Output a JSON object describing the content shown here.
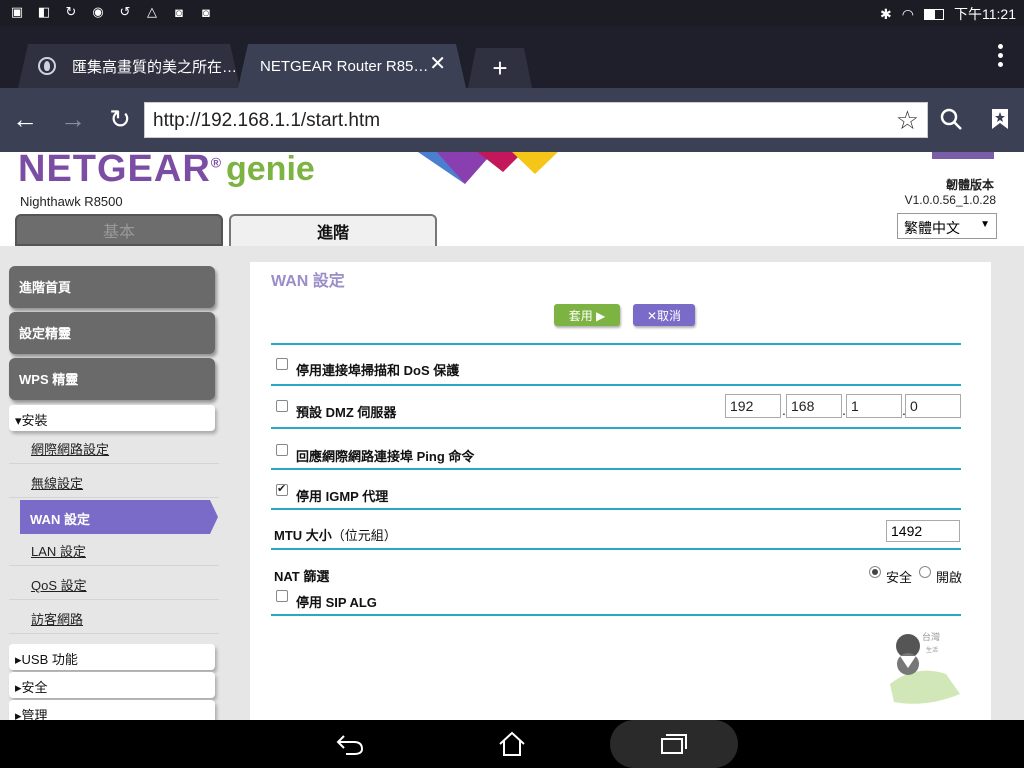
{
  "status_bar": {
    "time": "下午11:21",
    "left_icons": [
      "image-icon",
      "asus-icon",
      "sync-icon",
      "app-icon",
      "refresh-icon",
      "warning-icon",
      "camera-icon",
      "camera-icon"
    ],
    "right_icons": [
      "bluetooth-icon",
      "wifi-icon",
      "battery-icon"
    ]
  },
  "browser": {
    "tabs": [
      {
        "title": "匯集高畫質的美之所在…",
        "active": false
      },
      {
        "title": "NETGEAR Router R85…",
        "active": true
      }
    ],
    "new_tab_label": "+",
    "url": "http://192.168.1.1/start.htm"
  },
  "router_header": {
    "brand": "NETGEAR",
    "trademark": "®",
    "product": "genie",
    "model": "Nighthawk R8500",
    "firmware_label": "韌體版本",
    "firmware_version": "V1.0.0.56_1.0.28",
    "language": "繁體中文",
    "tabs": {
      "basic": "基本",
      "advanced": "進階"
    }
  },
  "sidebar": {
    "big_buttons": [
      "進階首頁",
      "設定精靈",
      "WPS 精靈"
    ],
    "setup_group": "▾安裝",
    "setup_items": [
      {
        "label": "網際網路設定",
        "active": false
      },
      {
        "label": "無線設定",
        "active": false
      },
      {
        "label": "WAN 設定",
        "active": true
      },
      {
        "label": "LAN 設定",
        "active": false
      },
      {
        "label": "QoS 設定",
        "active": false
      },
      {
        "label": "訪客網路",
        "active": false
      }
    ],
    "collapsed_groups": [
      "▸USB 功能",
      "▸安全",
      "▸管理"
    ]
  },
  "wan": {
    "title": "WAN 設定",
    "apply_label": "套用 ▶",
    "cancel_label": "✕取消",
    "disable_portscan_dos": {
      "label": "停用連接埠掃描和 DoS 保護",
      "checked": false
    },
    "default_dmz": {
      "label": "預設 DMZ 伺服器",
      "checked": false,
      "ip": [
        "192",
        "168",
        "1",
        "0"
      ]
    },
    "respond_ping": {
      "label": "回應網際網路連接埠 Ping 命令",
      "checked": false
    },
    "disable_igmp": {
      "label": "停用 IGMP 代理",
      "checked": true
    },
    "mtu": {
      "label": "MTU 大小",
      "unit": "（位元組）",
      "value": "1492"
    },
    "nat": {
      "label": "NAT 篩選",
      "options": [
        "安全",
        "開啟"
      ],
      "selected": "安全"
    },
    "disable_sip_alg": {
      "label": "停用 SIP ALG",
      "checked": false
    }
  },
  "nav_bar": {
    "icons": [
      "back-icon",
      "home-icon",
      "recents-icon"
    ]
  }
}
